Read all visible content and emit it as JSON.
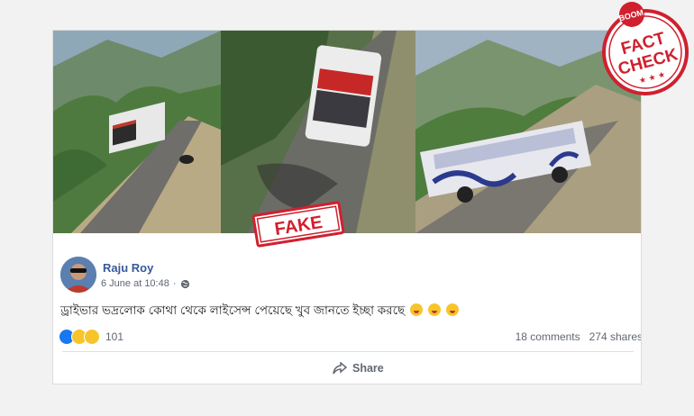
{
  "post": {
    "author": "Raju Roy",
    "date": "6 June at 10:48",
    "date_sep": "·",
    "text": "ড্রাইভার ভদ্রলোক কোথা থেকে লাইসেন্স পেয়েছে খুব জানতে ইচ্ছা করছে",
    "reaction_count": "101",
    "comments": "18 comments",
    "shares": "274 shares",
    "share_label": "Share"
  },
  "stamps": {
    "fake": "FAKE",
    "boom": "BOOM",
    "fact": "FACT",
    "check": "CHECK"
  },
  "colors": {
    "author_link": "#385898",
    "stamp_red": "#d0202e",
    "facebook_blue": "#1877f2"
  }
}
